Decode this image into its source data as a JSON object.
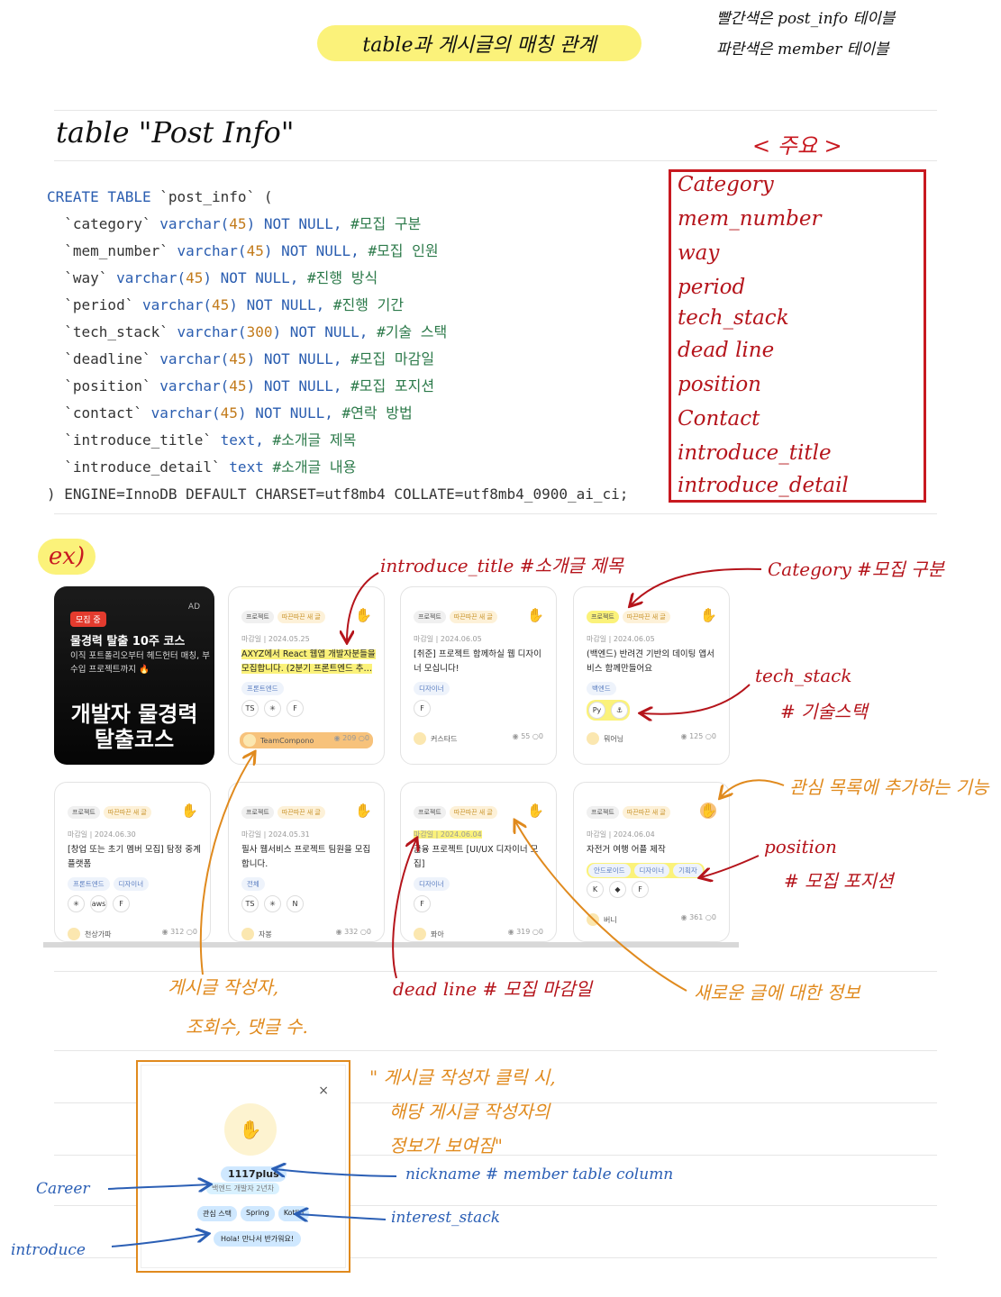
{
  "header": {
    "title": "table과 게시글의 매칭 관계",
    "legend_red": "빨간색은 post_info 테이블",
    "legend_blue": "파란색은 member 테이블"
  },
  "table_title": "table \"Post Info\"",
  "sql": {
    "create_kw": "CREATE TABLE",
    "table_name": "`post_info` (",
    "rows": [
      {
        "col": "`category`",
        "type": "varchar(",
        "n": "45",
        "tail": ") NOT NULL,",
        "comment": "#모집 구분"
      },
      {
        "col": "`mem_number`",
        "type": "varchar(",
        "n": "45",
        "tail": ") NOT NULL,",
        "comment": "#모집 인원"
      },
      {
        "col": "`way`",
        "type": "varchar(",
        "n": "45",
        "tail": ") NOT NULL,",
        "comment": "#진행 방식"
      },
      {
        "col": "`period`",
        "type": "varchar(",
        "n": "45",
        "tail": ") NOT NULL,",
        "comment": "#진행 기간"
      },
      {
        "col": "`tech_stack`",
        "type": "varchar(",
        "n": "300",
        "tail": ") NOT NULL,",
        "comment": "#기술 스택"
      },
      {
        "col": "`deadline`",
        "type": "varchar(",
        "n": "45",
        "tail": ") NOT NULL,",
        "comment": "#모집 마감일"
      },
      {
        "col": "`position`",
        "type": "varchar(",
        "n": "45",
        "tail": ") NOT NULL,",
        "comment": "#모집 포지션"
      },
      {
        "col": "`contact`",
        "type": "varchar(",
        "n": "45",
        "tail": ") NOT NULL,",
        "comment": "#연락 방법"
      },
      {
        "col": "`introduce_title`",
        "type": "text,",
        "n": "",
        "tail": "",
        "comment": "#소개글 제목"
      },
      {
        "col": "`introduce_detail`",
        "type": "text",
        "n": "",
        "tail": "",
        "comment": "#소개글 내용"
      }
    ],
    "footer": ") ENGINE=InnoDB DEFAULT CHARSET=utf8mb4 COLLATE=utf8mb4_0900_ai_ci;"
  },
  "main_cols": {
    "title": "< 주요 >",
    "items": [
      "Category",
      "mem_number",
      "way",
      "period",
      "tech_stack",
      "dead line",
      "position",
      "Contact",
      "introduce_title",
      "introduce_detail"
    ]
  },
  "example_label": "ex)",
  "ad": {
    "badge": "모집 중",
    "tag": "AD",
    "heading": "물경력 탈출 10주 코스",
    "sub": "이직 포트폴리오부터 헤드헌터 매칭, 부수입 프로젝트까지 🔥",
    "big1": "개발자 물경력",
    "big2": "탈출코스"
  },
  "cards": [
    {
      "cat": "프로젝트",
      "new": "따끈따끈 새 글",
      "deadline": "마감일 | 2024.05.25",
      "title": "AXYZ에서 React 웹앱 개발자분들을 모집합니다. (2분기 프론트엔드 추…",
      "pos": [
        "프론트엔드"
      ],
      "stack": [
        "TS",
        "✳",
        "F"
      ],
      "author": "TeamCompono",
      "views": "209",
      "comments": "0"
    },
    {
      "cat": "프로젝트",
      "new": "따끈따끈 새 글",
      "deadline": "마감일 | 2024.06.05",
      "title": "[취준] 프로젝트 함께하실 웹 디자이너 모십니다!",
      "pos": [
        "디자이너"
      ],
      "stack": [
        "F"
      ],
      "author": "커스타드",
      "views": "55",
      "comments": "0"
    },
    {
      "cat": "프로젝트",
      "new": "따끈따끈 새 글",
      "deadline": "마감일 | 2024.06.05",
      "title": "(백엔드) 반려견 기반의 데이팅 앱서비스 함께만들어요",
      "pos": [
        "백엔드"
      ],
      "stack": [
        "Py",
        "⚓"
      ],
      "author": "뭐어닝",
      "views": "125",
      "comments": "0"
    },
    {
      "cat": "프로젝트",
      "new": "따끈따끈 새 글",
      "deadline": "마감일 | 2024.06.30",
      "title": "[창업 또는 초기 멤버 모집] 탐정 중계 플랫폼",
      "pos": [
        "프론트엔드",
        "디자이너"
      ],
      "stack": [
        "✳",
        "aws",
        "F"
      ],
      "author": "천상가파",
      "views": "312",
      "comments": "0"
    },
    {
      "cat": "프로젝트",
      "new": "따끈따끈 새 글",
      "deadline": "마감일 | 2024.05.31",
      "title": "필사 웹서비스 프로젝트 팀원을 모집합니다.",
      "pos": [
        "전체"
      ],
      "stack": [
        "TS",
        "✳",
        "N"
      ],
      "author": "자봉",
      "views": "332",
      "comments": "0"
    },
    {
      "cat": "프로젝트",
      "new": "따끈따끈 새 글",
      "deadline": "마감일 | 2024.06.04",
      "title": "금융 프로젝트 [UI/UX 디자이너 모집]",
      "pos": [
        "디자이너"
      ],
      "stack": [
        "F"
      ],
      "author": "퐈아",
      "views": "319",
      "comments": "0"
    },
    {
      "cat": "프로젝트",
      "new": "따끈따끈 새 글",
      "deadline": "마감일 | 2024.06.04",
      "title": "자전거 여행 어플 제작",
      "pos": [
        "안드로이드",
        "디자이너",
        "기획자"
      ],
      "stack": [
        "K",
        "◆",
        "F"
      ],
      "author": "버니",
      "views": "361",
      "comments": "0"
    }
  ],
  "annotations": {
    "introduce_title": "introduce_title #소개글 제목",
    "category": "Category #모집 구분",
    "tech_stack": "tech_stack",
    "tech_stack_kr": "# 기술스택",
    "bookmark": "관심 목록에 추가하는 기능",
    "position": "position",
    "position_kr": "# 모집 포지션",
    "author1": "게시글 작성자,",
    "author2": "조회수, 댓글 수.",
    "deadline": "dead line # 모집 마감일",
    "new_post": "새로운 글에 대한 정보",
    "modal_note1": "\" 게시글 작성자 클릭 시,",
    "modal_note2": "해당 게시글 작성자의",
    "modal_note3": "정보가 보여짐\"",
    "nickname": "nickname  # member table column",
    "career": "Career",
    "interest_stack": "interest_stack",
    "introduce": "introduce"
  },
  "modal": {
    "close": "×",
    "nickname": "1117plus",
    "career": "백엔드 개발자 2년차",
    "stack_label": "관심 스택",
    "stacks": [
      "Spring",
      "Kotlin"
    ],
    "intro": "Hola! 만나서 반가워요!"
  },
  "colors": {
    "red": "#c81920",
    "orange": "#e08a1e",
    "blue": "#2b5fb5",
    "highlight": "#fbf27a"
  }
}
